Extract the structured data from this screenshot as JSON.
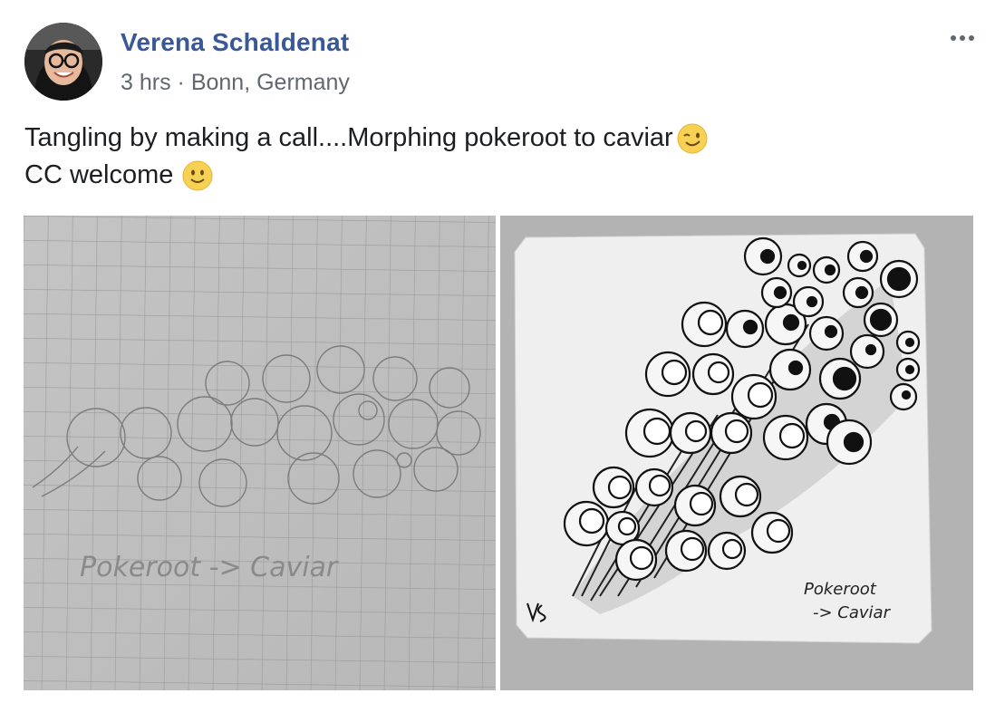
{
  "post": {
    "author": "Verena Schaldenat",
    "time": "3 hrs",
    "separator": "·",
    "location": "Bonn, Germany",
    "text_line1": "Tangling by making a call....Morphing pokeroot to caviar",
    "text_line2": "CC welcome"
  },
  "photos": {
    "left": {
      "caption": "Pokeroot -> Caviar"
    },
    "right": {
      "caption_line1": "Pokeroot",
      "caption_line2": "-> Caviar",
      "signature": "VS"
    }
  },
  "icons": {
    "more": "more-options-icon",
    "emoji1": "winking-face-icon",
    "emoji2": "slightly-smiling-face-icon"
  },
  "colors": {
    "author_link": "#385898",
    "meta_text": "#616770",
    "body_text": "#1c1e21"
  }
}
